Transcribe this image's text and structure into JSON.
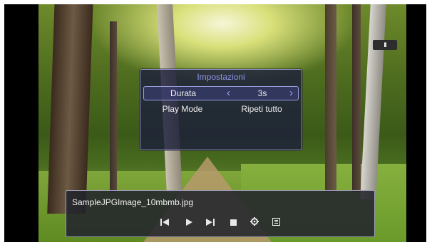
{
  "dialog": {
    "title": "Impostazioni",
    "rows": [
      {
        "label": "Durata",
        "value": "3s",
        "selected": true
      },
      {
        "label": "Play Mode",
        "value": "Ripeti tutto",
        "selected": false
      }
    ]
  },
  "player": {
    "filename": "SampleJPGImage_10mbmb.jpg",
    "state_badge": "II",
    "controls": [
      "previous-icon",
      "play-icon",
      "next-icon",
      "stop-icon",
      "gear-icon",
      "menu-icon"
    ]
  },
  "colors": {
    "dialog_title": "#8d96e6",
    "accent": "#9aa3ff"
  }
}
